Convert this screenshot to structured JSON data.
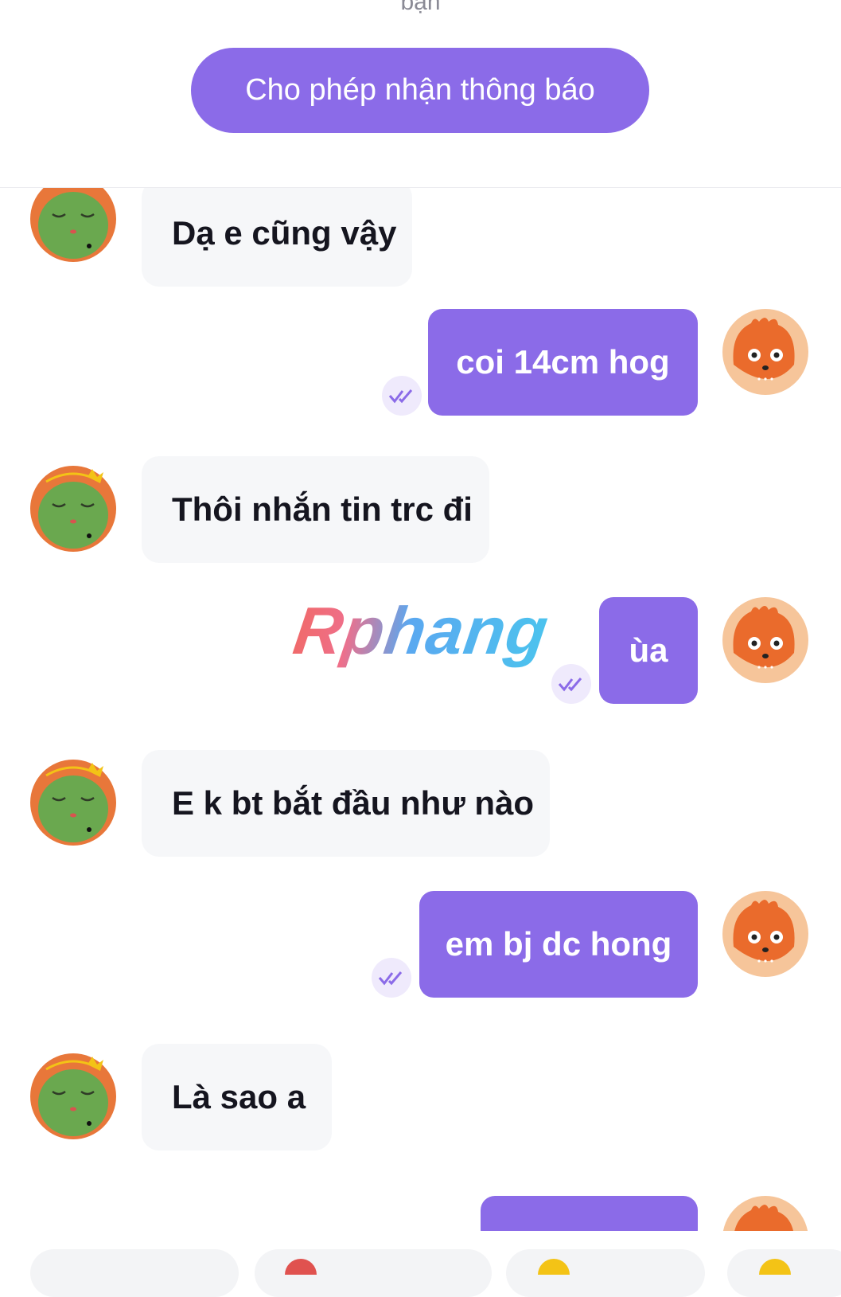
{
  "header": {
    "cut_text": "bạn",
    "notify_button": "Cho phép nhận thông báo"
  },
  "watermark": "Rphang",
  "messages": [
    {
      "side": "in",
      "text": "Dạ e cũng vậy"
    },
    {
      "side": "out",
      "text": "coi 14cm hog"
    },
    {
      "side": "in",
      "text": "Thôi nhắn tin trc đi"
    },
    {
      "side": "out",
      "text": "ùa"
    },
    {
      "side": "in",
      "text": "E k bt bắt đầu như nào"
    },
    {
      "side": "out",
      "text": "em bj dc hong"
    },
    {
      "side": "in",
      "text": "Là sao a"
    },
    {
      "side": "out",
      "text": ""
    }
  ],
  "colors": {
    "accent": "#8b6be8",
    "incoming_bubble": "#f6f7f9",
    "seen_tick_bg": "#efeafc"
  },
  "icons": {
    "incoming_avatar": "green-dragon-avatar-icon",
    "outgoing_avatar": "orange-monster-avatar-icon",
    "seen": "double-check-icon"
  }
}
